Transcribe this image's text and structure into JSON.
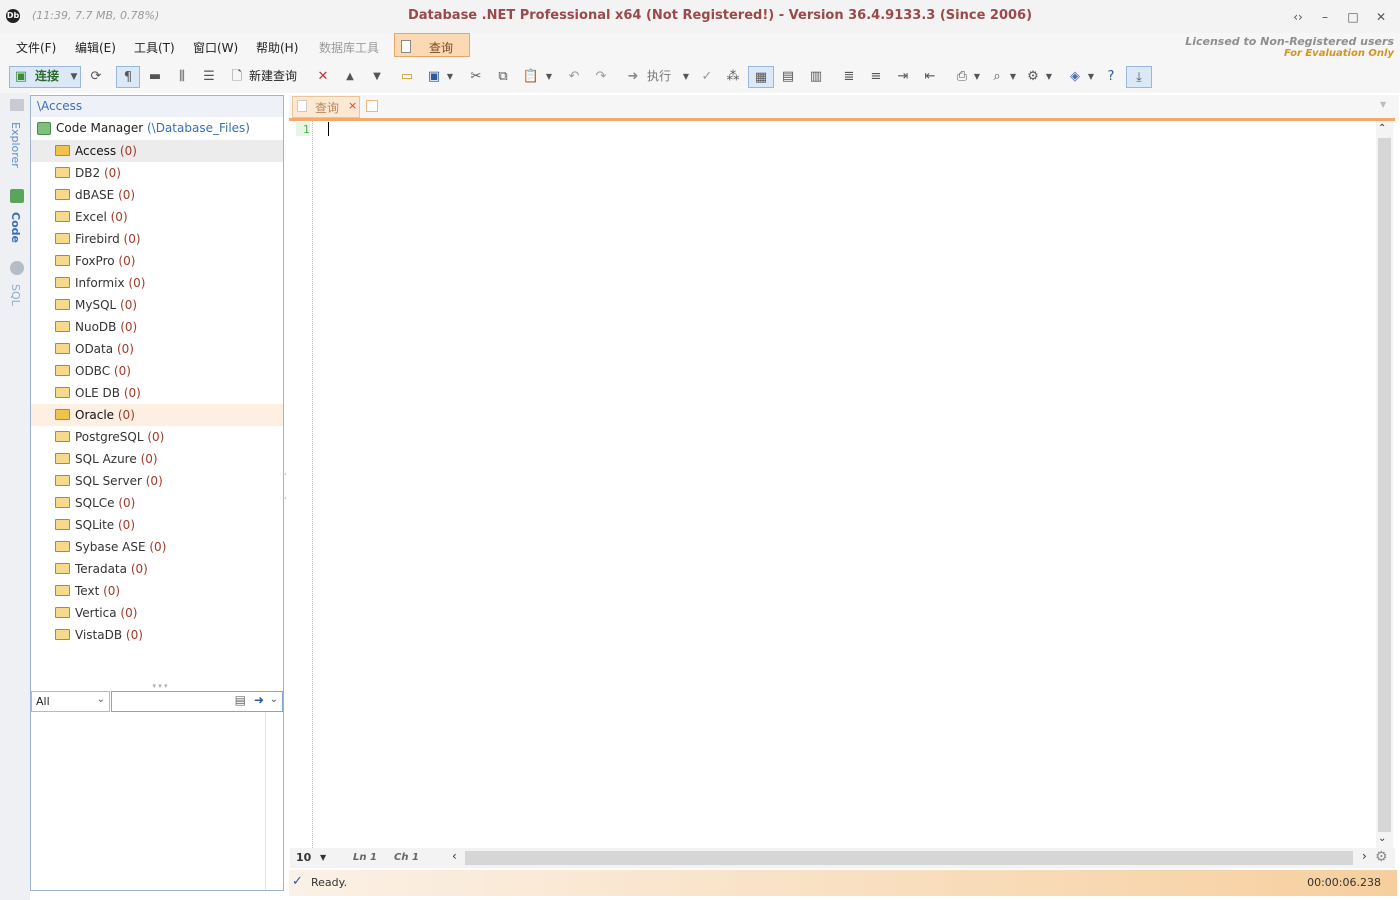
{
  "titlebar": {
    "status_info": "(11:39, 7.7 MB, 0.78%)",
    "title": "Database .NET Professional x64 (Not Registered!)  -  Version 36.4.9133.3 (Since 2006)",
    "nav_glyph": "‹›",
    "minimize_glyph": "–",
    "maximize_glyph": "□",
    "close_glyph": "✕"
  },
  "menu": {
    "file": "文件(F)",
    "edit": "编辑(E)",
    "tools": "工具(T)",
    "window": "窗口(W)",
    "help": "帮助(H)",
    "db_tools": "数据库工具",
    "query": "查询"
  },
  "license": {
    "line1": "Licensed to Non-Registered users",
    "line2": "For Evaluation Only"
  },
  "toolbar": {
    "connect": "连接",
    "new_query": "新建查询",
    "execute": "执行"
  },
  "leftstrip": {
    "explorer": "Explorer",
    "code": "Code",
    "sql": "SQL"
  },
  "explorer": {
    "path": "\\Access",
    "root_label": "Code Manager",
    "root_path": "(\\Database_Files)",
    "items": [
      {
        "name": "Access",
        "count": "(0)"
      },
      {
        "name": "DB2",
        "count": "(0)"
      },
      {
        "name": "dBASE",
        "count": "(0)"
      },
      {
        "name": "Excel",
        "count": "(0)"
      },
      {
        "name": "Firebird",
        "count": "(0)"
      },
      {
        "name": "FoxPro",
        "count": "(0)"
      },
      {
        "name": "Informix",
        "count": "(0)"
      },
      {
        "name": "MySQL",
        "count": "(0)"
      },
      {
        "name": "NuoDB",
        "count": "(0)"
      },
      {
        "name": "OData",
        "count": "(0)"
      },
      {
        "name": "ODBC",
        "count": "(0)"
      },
      {
        "name": "OLE DB",
        "count": "(0)"
      },
      {
        "name": "Oracle",
        "count": "(0)"
      },
      {
        "name": "PostgreSQL",
        "count": "(0)"
      },
      {
        "name": "SQL Azure",
        "count": "(0)"
      },
      {
        "name": "SQL Server",
        "count": "(0)"
      },
      {
        "name": "SQLCe",
        "count": "(0)"
      },
      {
        "name": "SQLite",
        "count": "(0)"
      },
      {
        "name": "Sybase ASE",
        "count": "(0)"
      },
      {
        "name": "Teradata",
        "count": "(0)"
      },
      {
        "name": "Text",
        "count": "(0)"
      },
      {
        "name": "Vertica",
        "count": "(0)"
      },
      {
        "name": "VistaDB",
        "count": "(0)"
      }
    ],
    "filter_value": "All",
    "search_value": ""
  },
  "editor": {
    "tab_label": "查询",
    "line_number": "1",
    "font_size": "10",
    "ln": "Ln 1",
    "ch": "Ch 1"
  },
  "status": {
    "text": "Ready.",
    "elapsed": "00:00:06.238"
  },
  "colors": {
    "accent": "#f2a96a",
    "title_text": "#9b4a4a",
    "tree_count": "#a23a2a"
  }
}
